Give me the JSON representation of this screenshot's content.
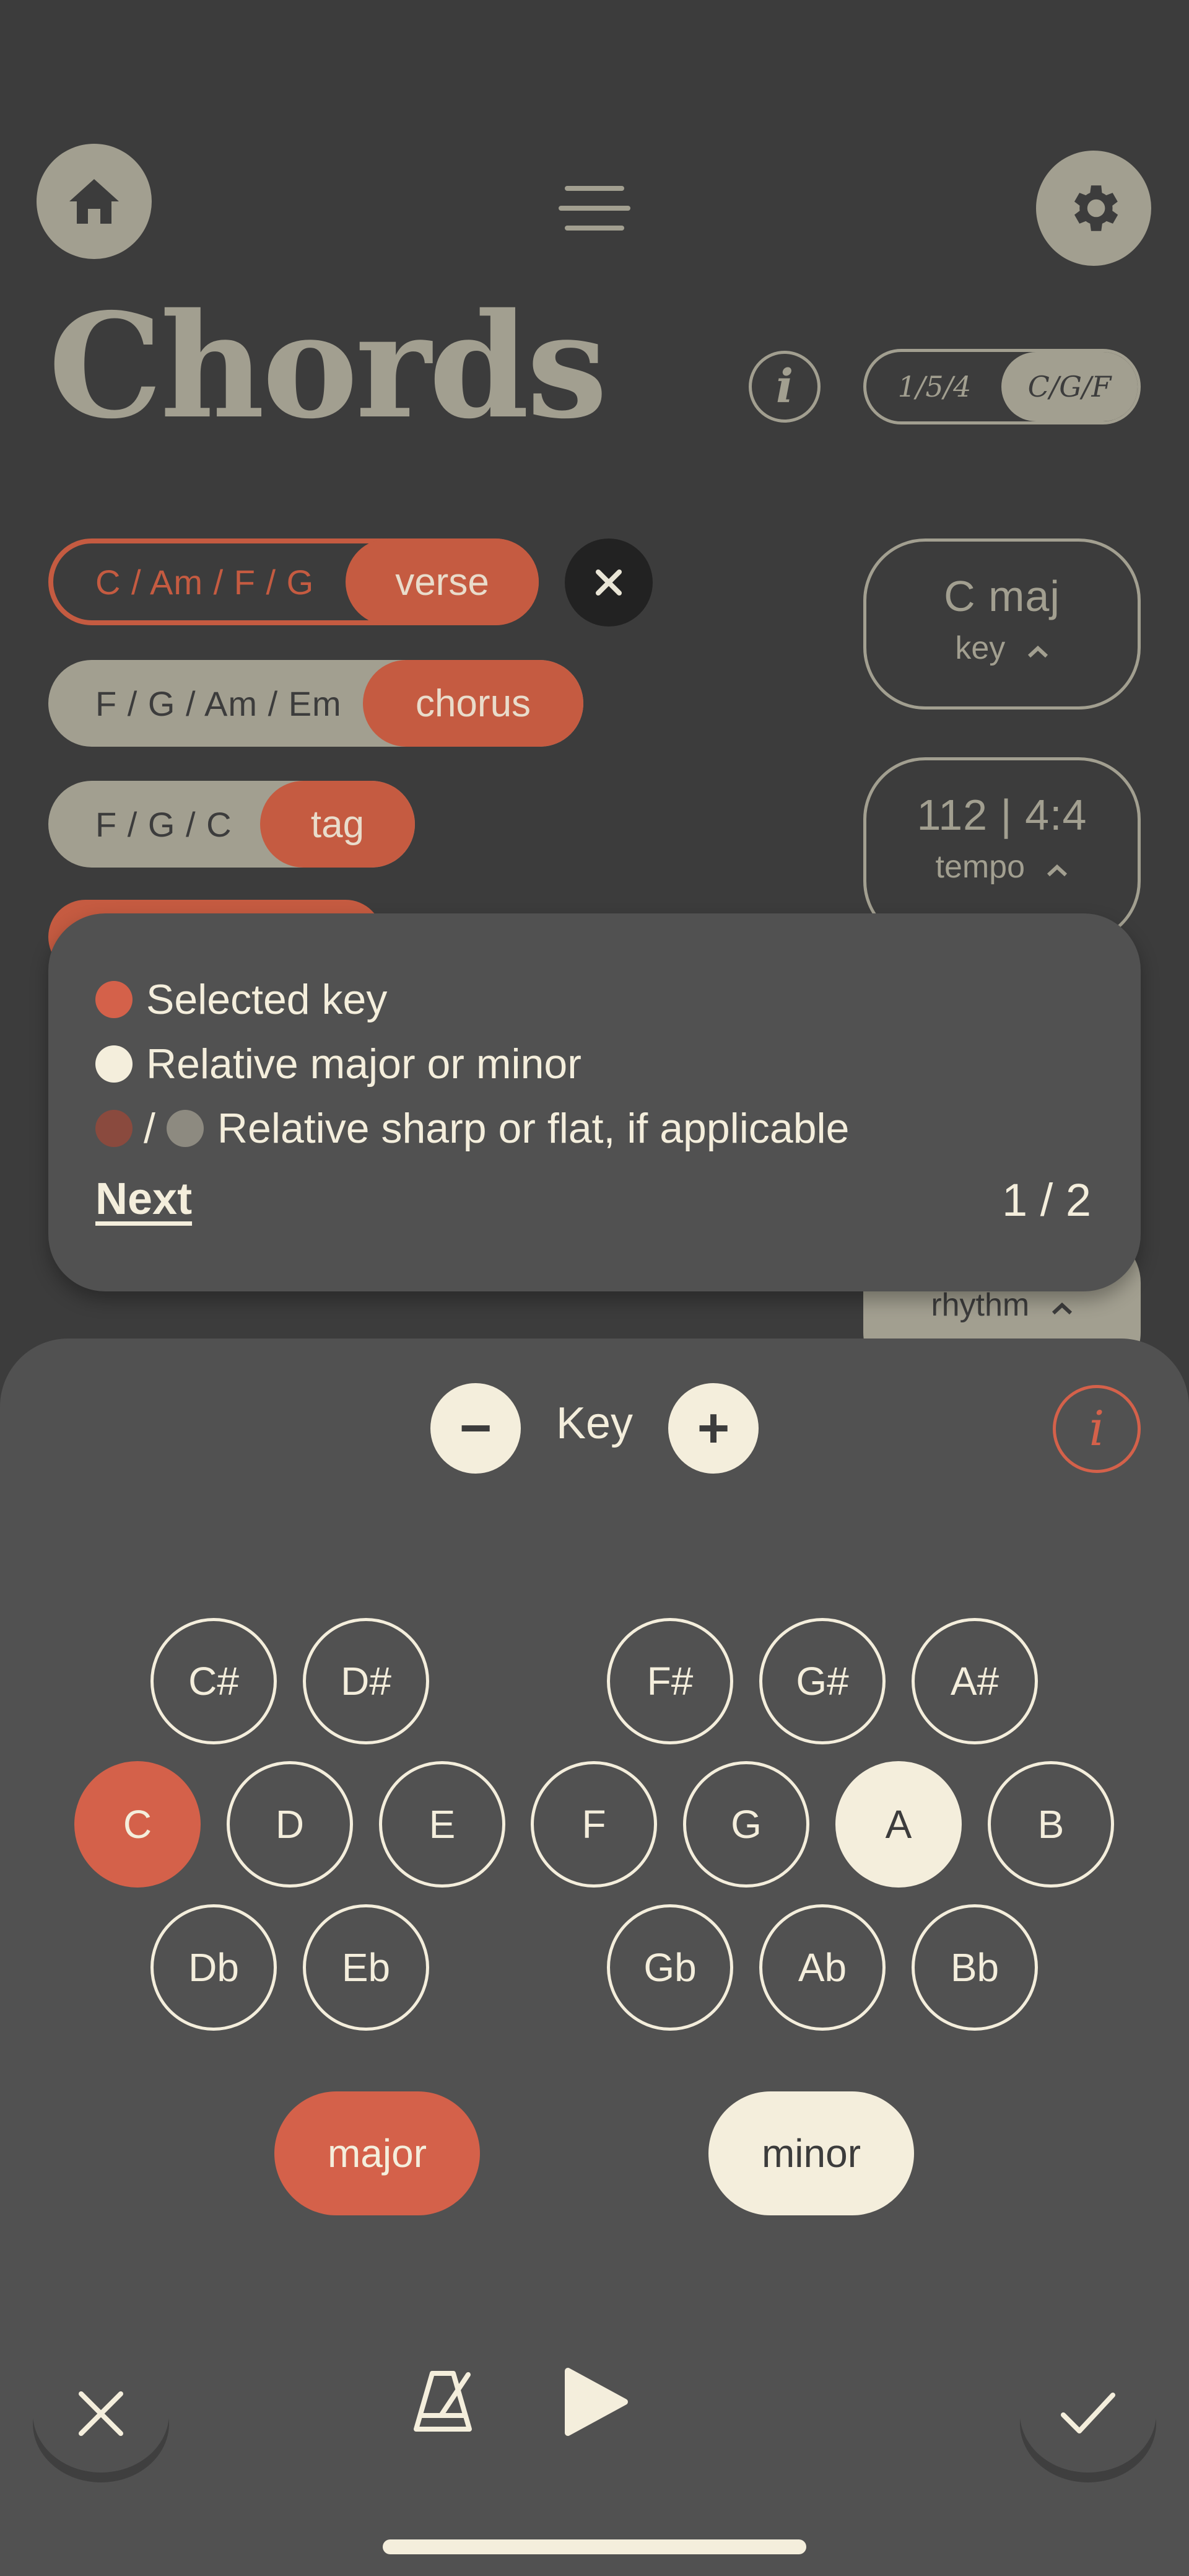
{
  "header": {
    "title": "Chords",
    "info_icon": "i",
    "numbering_toggle": {
      "options": [
        "1/5/4",
        "C/G/F"
      ],
      "selected": "C/G/F"
    }
  },
  "sections": [
    {
      "chords": "C / Am / F / G",
      "tag": "verse",
      "active": true
    },
    {
      "chords": "F / G / Am / Em",
      "tag": "chorus",
      "active": false
    },
    {
      "chords": "F / G / C",
      "tag": "tag",
      "active": false
    }
  ],
  "key_card": {
    "value": "C maj",
    "label": "key"
  },
  "tempo_card": {
    "value": "112 | 4:4",
    "label": "tempo"
  },
  "rhythm_card": {
    "label": "rhythm"
  },
  "tooltip": {
    "items": [
      {
        "text": "Selected key"
      },
      {
        "text": "Relative major or minor"
      },
      {
        "separator": "/",
        "text": "Relative sharp or flat, if applicable"
      }
    ],
    "next_label": "Next",
    "page": "1 / 2"
  },
  "key_picker": {
    "label": "Key",
    "decrement": "−",
    "increment": "+",
    "info_icon": "i",
    "sharps": [
      "C#",
      "D#",
      "F#",
      "G#",
      "A#"
    ],
    "naturals": [
      "C",
      "D",
      "E",
      "F",
      "G",
      "A",
      "B"
    ],
    "flats": [
      "Db",
      "Eb",
      "Gb",
      "Ab",
      "Bb"
    ],
    "selected_key": "C",
    "relative_key": "A",
    "modes": [
      "major",
      "minor"
    ],
    "selected_mode": "major"
  },
  "colors": {
    "background": "#3c3c3c",
    "panel": "#515151",
    "accent": "#d4614a",
    "accent_dark": "#c55b41",
    "muted": "#a29f90",
    "cream": "#f4eedc"
  }
}
